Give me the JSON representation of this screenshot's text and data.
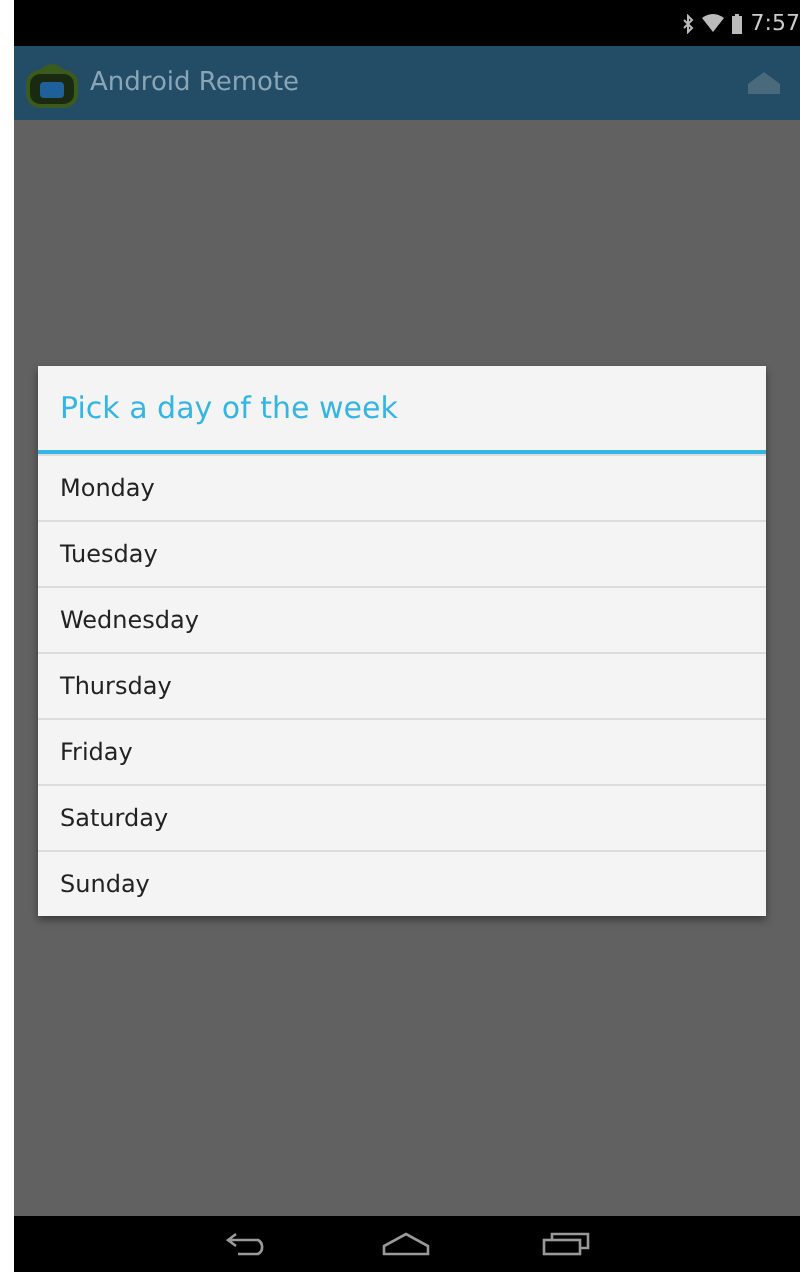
{
  "status_bar": {
    "time": "7:57"
  },
  "app_bar": {
    "title": "Android Remote"
  },
  "dialog": {
    "title": "Pick a day of the week",
    "items": [
      {
        "label": "Monday"
      },
      {
        "label": "Tuesday"
      },
      {
        "label": "Wednesday"
      },
      {
        "label": "Thursday"
      },
      {
        "label": "Friday"
      },
      {
        "label": "Saturday"
      },
      {
        "label": "Sunday"
      }
    ]
  }
}
